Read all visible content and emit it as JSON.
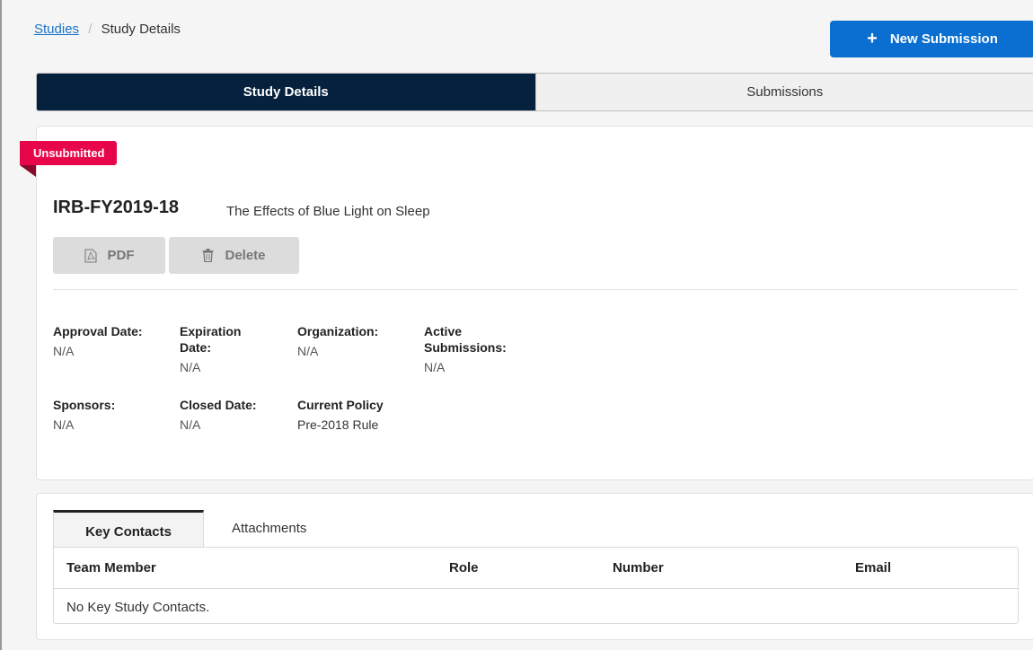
{
  "breadcrumb": {
    "link": "Studies",
    "separator": "/",
    "current": "Study Details"
  },
  "actions": {
    "new_submission": "New Submission"
  },
  "main_tabs": [
    {
      "label": "Study Details",
      "active": true
    },
    {
      "label": "Submissions",
      "active": false
    }
  ],
  "study": {
    "status": "Unsubmitted",
    "id": "IRB-FY2019-18",
    "title": "The Effects of Blue Light on Sleep",
    "pdf_label": "PDF",
    "delete_label": "Delete",
    "fields": {
      "approval_date": {
        "label": "Approval Date:",
        "value": "N/A"
      },
      "expiration_date": {
        "label_line1": "Expiration",
        "label_line2": "Date:",
        "value": "N/A"
      },
      "organization": {
        "label": "Organization:",
        "value": "N/A"
      },
      "active_submissions": {
        "label_line1": "Active",
        "label_line2": "Submissions:",
        "value": "N/A"
      },
      "sponsors": {
        "label": "Sponsors:",
        "value": "N/A"
      },
      "closed_date": {
        "label": "Closed Date:",
        "value": "N/A"
      },
      "current_policy": {
        "label": "Current Policy",
        "value": "Pre-2018 Rule"
      }
    }
  },
  "contacts": {
    "tabs": [
      {
        "label": "Key Contacts",
        "active": true
      },
      {
        "label": "Attachments",
        "active": false
      }
    ],
    "columns": [
      "Team Member",
      "Role",
      "Number",
      "Email"
    ],
    "empty_message": "No Key Study Contacts."
  },
  "colors": {
    "primary": "#0a6fd0",
    "nav_active": "#05213d",
    "status_badge": "#e8064a"
  }
}
